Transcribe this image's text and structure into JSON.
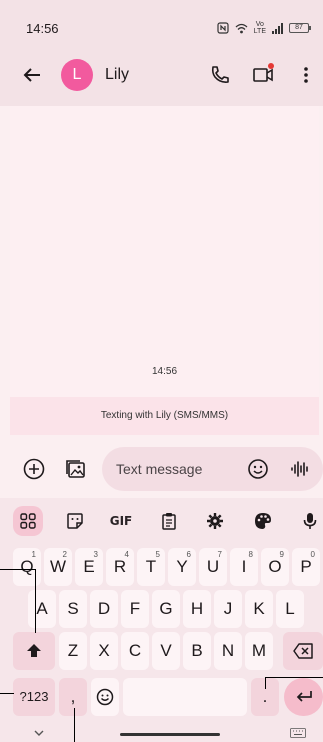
{
  "status_bar": {
    "time": "14:56",
    "volte_top": "Vo",
    "volte_bottom": "LTE",
    "battery": "87"
  },
  "app_bar": {
    "avatar_letter": "L",
    "contact_name": "Lily",
    "avatar_color": "#f25a9e"
  },
  "conversation": {
    "message_time": "14:56",
    "banner": "Texting with Lily (SMS/MMS)"
  },
  "compose": {
    "placeholder": "Text message"
  },
  "keyboard": {
    "gif_label": "GIF",
    "row1": [
      {
        "label": "Q",
        "hint": "1"
      },
      {
        "label": "W",
        "hint": "2"
      },
      {
        "label": "E",
        "hint": "3"
      },
      {
        "label": "R",
        "hint": "4"
      },
      {
        "label": "T",
        "hint": "5"
      },
      {
        "label": "Y",
        "hint": "6"
      },
      {
        "label": "U",
        "hint": "7"
      },
      {
        "label": "I",
        "hint": "8"
      },
      {
        "label": "O",
        "hint": "9"
      },
      {
        "label": "P",
        "hint": "0"
      }
    ],
    "row2": [
      "A",
      "S",
      "D",
      "F",
      "G",
      "H",
      "J",
      "K",
      "L"
    ],
    "row3": [
      "Z",
      "X",
      "C",
      "V",
      "B",
      "N",
      "M"
    ],
    "symbols_label": "?123",
    "comma_label": ",",
    "period_label": "."
  }
}
